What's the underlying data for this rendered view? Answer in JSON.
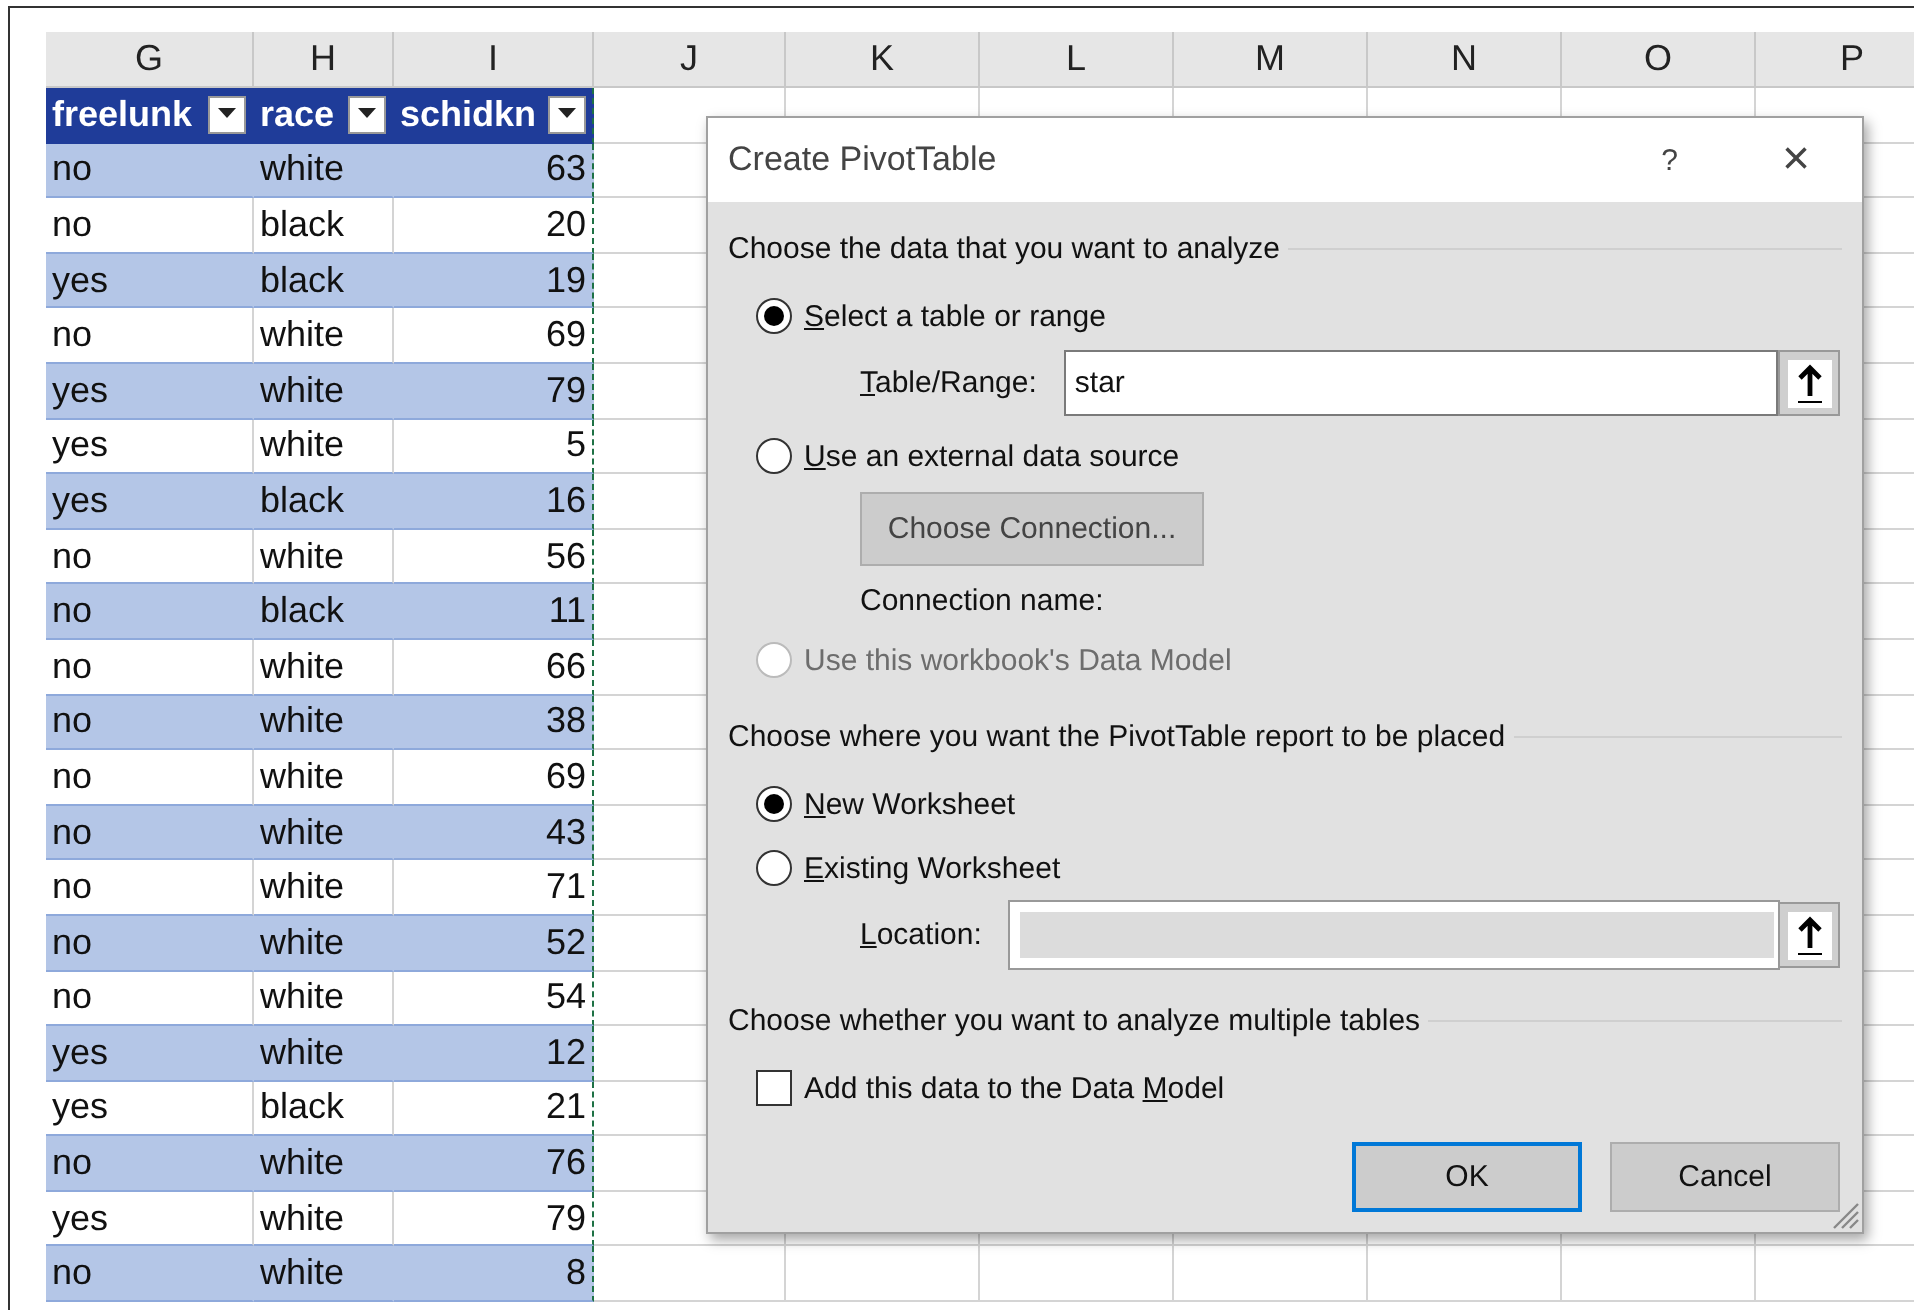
{
  "sheet": {
    "columns": [
      "G",
      "H",
      "I",
      "J",
      "K",
      "L",
      "M",
      "N",
      "O",
      "P"
    ],
    "table": {
      "headers": [
        "freelunk",
        "race",
        "schidkn"
      ],
      "rows": [
        [
          "no",
          "white",
          "63"
        ],
        [
          "no",
          "black",
          "20"
        ],
        [
          "yes",
          "black",
          "19"
        ],
        [
          "no",
          "white",
          "69"
        ],
        [
          "yes",
          "white",
          "79"
        ],
        [
          "yes",
          "white",
          "5"
        ],
        [
          "yes",
          "black",
          "16"
        ],
        [
          "no",
          "white",
          "56"
        ],
        [
          "no",
          "black",
          "11"
        ],
        [
          "no",
          "white",
          "66"
        ],
        [
          "no",
          "white",
          "38"
        ],
        [
          "no",
          "white",
          "69"
        ],
        [
          "no",
          "white",
          "43"
        ],
        [
          "no",
          "white",
          "71"
        ],
        [
          "no",
          "white",
          "52"
        ],
        [
          "no",
          "white",
          "54"
        ],
        [
          "yes",
          "white",
          "12"
        ],
        [
          "yes",
          "black",
          "21"
        ],
        [
          "no",
          "white",
          "76"
        ],
        [
          "yes",
          "white",
          "79"
        ],
        [
          "no",
          "white",
          "8"
        ]
      ]
    }
  },
  "dialog": {
    "title": "Create PivotTable",
    "help": "?",
    "close": "×",
    "sections": [
      {
        "heading": "Choose the data that you want to analyze",
        "items": [
          {
            "kind": "radio",
            "key": "S",
            "rest": "elect a table or range",
            "selected": true,
            "disabled": false
          },
          {
            "kind": "field",
            "key": "T",
            "rest": "able/Range:",
            "value": "star",
            "disabled": false
          },
          {
            "kind": "radio",
            "key": "U",
            "rest": "se an external data source",
            "selected": false,
            "disabled": false
          },
          {
            "kind": "button",
            "text": "Choose Connection...",
            "disabled": true
          },
          {
            "kind": "note",
            "text": "Connection name:"
          },
          {
            "kind": "radio",
            "text": "Use this workbook's Data Model",
            "selected": false,
            "disabled": true
          }
        ]
      },
      {
        "heading": "Choose where you want the PivotTable report to be placed",
        "items": [
          {
            "kind": "radio",
            "key": "N",
            "rest": "ew Worksheet",
            "selected": true,
            "disabled": false
          },
          {
            "kind": "radio",
            "key": "E",
            "rest": "xisting Worksheet",
            "selected": false,
            "disabled": false
          },
          {
            "kind": "field",
            "key": "L",
            "rest": "ocation:",
            "disabled": true
          }
        ]
      },
      {
        "heading": "Choose whether you want to analyze multiple tables",
        "items": [
          {
            "kind": "checkbox",
            "text": "Add this data to the Data ",
            "key": "M",
            "rest": "odel",
            "checked": false,
            "disabled": false
          }
        ]
      }
    ],
    "buttons": [
      {
        "label": "OK",
        "default": true
      },
      {
        "label": "Cancel",
        "default": false
      }
    ]
  }
}
